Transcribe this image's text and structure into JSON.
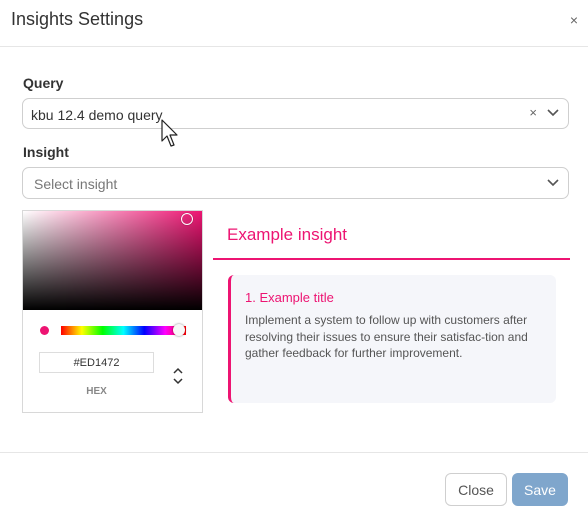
{
  "dialog": {
    "title": "Insights Settings",
    "close_icon": "×"
  },
  "query": {
    "label": "Query",
    "value": "kbu 12.4 demo query",
    "clear_icon": "×"
  },
  "insight": {
    "label": "Insight",
    "placeholder": "Select insight"
  },
  "color_picker": {
    "hex_value": "#ED1472",
    "hex_label": "HEX",
    "color": "#ED1472"
  },
  "example": {
    "heading": "Example insight",
    "card_title": "1. Example title",
    "card_text": "Implement a system to follow up with customers after resolving their issues to ensure their satisfac-tion and gather feedback for further improvement."
  },
  "footer": {
    "close_label": "Close",
    "save_label": "Save"
  },
  "colors": {
    "accent": "#ED1472",
    "save_button": "#7FA6CC"
  }
}
